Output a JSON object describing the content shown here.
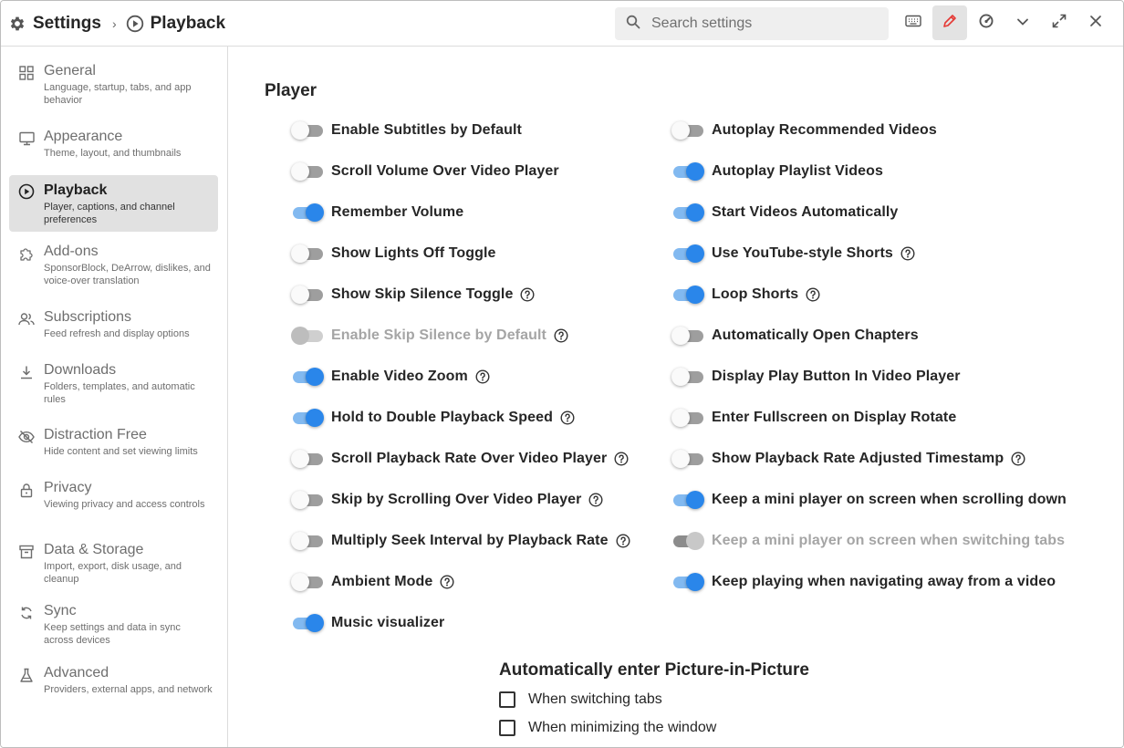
{
  "header": {
    "settings_label": "Settings",
    "page_label": "Playback",
    "search_placeholder": "Search settings"
  },
  "sidebar": {
    "items": [
      {
        "title": "General",
        "desc": "Language, startup, tabs, and app behavior",
        "icon": "grid-icon"
      },
      {
        "title": "Appearance",
        "desc": "Theme, layout, and thumbnails",
        "icon": "monitor-icon"
      },
      {
        "title": "Playback",
        "desc": "Player, captions, and channel preferences",
        "icon": "play-circle-icon",
        "active": true
      },
      {
        "title": "Add-ons",
        "desc": "SponsorBlock, DeArrow, dislikes, and voice-over translation",
        "icon": "puzzle-icon"
      },
      {
        "title": "Subscriptions",
        "desc": "Feed refresh and display options",
        "icon": "users-icon"
      },
      {
        "title": "Downloads",
        "desc": "Folders, templates, and automatic rules",
        "icon": "download-icon"
      },
      {
        "title": "Distraction Free",
        "desc": "Hide content and set viewing limits",
        "icon": "eye-off-icon"
      },
      {
        "title": "Privacy",
        "desc": "Viewing privacy and access controls",
        "icon": "lock-icon"
      },
      {
        "title": "Data & Storage",
        "desc": "Import, export, disk usage, and cleanup",
        "icon": "archive-icon"
      },
      {
        "title": "Sync",
        "desc": "Keep settings and data in sync across devices",
        "icon": "sync-icon"
      },
      {
        "title": "Advanced",
        "desc": "Providers, external apps, and network",
        "icon": "flask-icon"
      }
    ]
  },
  "main": {
    "section_title": "Player",
    "left_settings": [
      {
        "label": "Enable Subtitles by Default",
        "on": false,
        "help": false,
        "disabled": false
      },
      {
        "label": "Scroll Volume Over Video Player",
        "on": false,
        "help": false,
        "disabled": false
      },
      {
        "label": "Remember Volume",
        "on": true,
        "help": false,
        "disabled": false
      },
      {
        "label": "Show Lights Off Toggle",
        "on": false,
        "help": false,
        "disabled": false
      },
      {
        "label": "Show Skip Silence Toggle",
        "on": false,
        "help": true,
        "disabled": false
      },
      {
        "label": "Enable Skip Silence by Default",
        "on": false,
        "help": true,
        "disabled": true
      },
      {
        "label": "Enable Video Zoom",
        "on": true,
        "help": true,
        "disabled": false
      },
      {
        "label": "Hold to Double Playback Speed",
        "on": true,
        "help": true,
        "disabled": false
      },
      {
        "label": "Scroll Playback Rate Over Video Player",
        "on": false,
        "help": true,
        "disabled": false
      },
      {
        "label": "Skip by Scrolling Over Video Player",
        "on": false,
        "help": true,
        "disabled": false
      },
      {
        "label": "Multiply Seek Interval by Playback Rate",
        "on": false,
        "help": true,
        "disabled": false
      },
      {
        "label": "Ambient Mode",
        "on": false,
        "help": true,
        "disabled": false
      },
      {
        "label": "Music visualizer",
        "on": true,
        "help": false,
        "disabled": false
      }
    ],
    "right_settings": [
      {
        "label": "Autoplay Recommended Videos",
        "on": false,
        "help": false,
        "disabled": false
      },
      {
        "label": "Autoplay Playlist Videos",
        "on": true,
        "help": false,
        "disabled": false
      },
      {
        "label": "Start Videos Automatically",
        "on": true,
        "help": false,
        "disabled": false
      },
      {
        "label": "Use YouTube-style Shorts",
        "on": true,
        "help": true,
        "disabled": false
      },
      {
        "label": "Loop Shorts",
        "on": true,
        "help": true,
        "disabled": false
      },
      {
        "label": "Automatically Open Chapters",
        "on": false,
        "help": false,
        "disabled": false
      },
      {
        "label": "Display Play Button In Video Player",
        "on": false,
        "help": false,
        "disabled": false
      },
      {
        "label": "Enter Fullscreen on Display Rotate",
        "on": false,
        "help": false,
        "disabled": false
      },
      {
        "label": "Show Playback Rate Adjusted Timestamp",
        "on": false,
        "help": true,
        "disabled": false
      },
      {
        "label": "Keep a mini player on screen when scrolling down",
        "on": true,
        "help": false,
        "disabled": false
      },
      {
        "label": "Keep a mini player on screen when switching tabs",
        "on": true,
        "help": false,
        "disabled": true
      },
      {
        "label": "Keep playing when navigating away from a video",
        "on": true,
        "help": false,
        "disabled": false
      }
    ],
    "pip": {
      "title": "Automatically enter Picture-in-Picture",
      "options": [
        {
          "label": "When switching tabs",
          "checked": false
        },
        {
          "label": "When minimizing the window",
          "checked": false
        }
      ]
    }
  }
}
